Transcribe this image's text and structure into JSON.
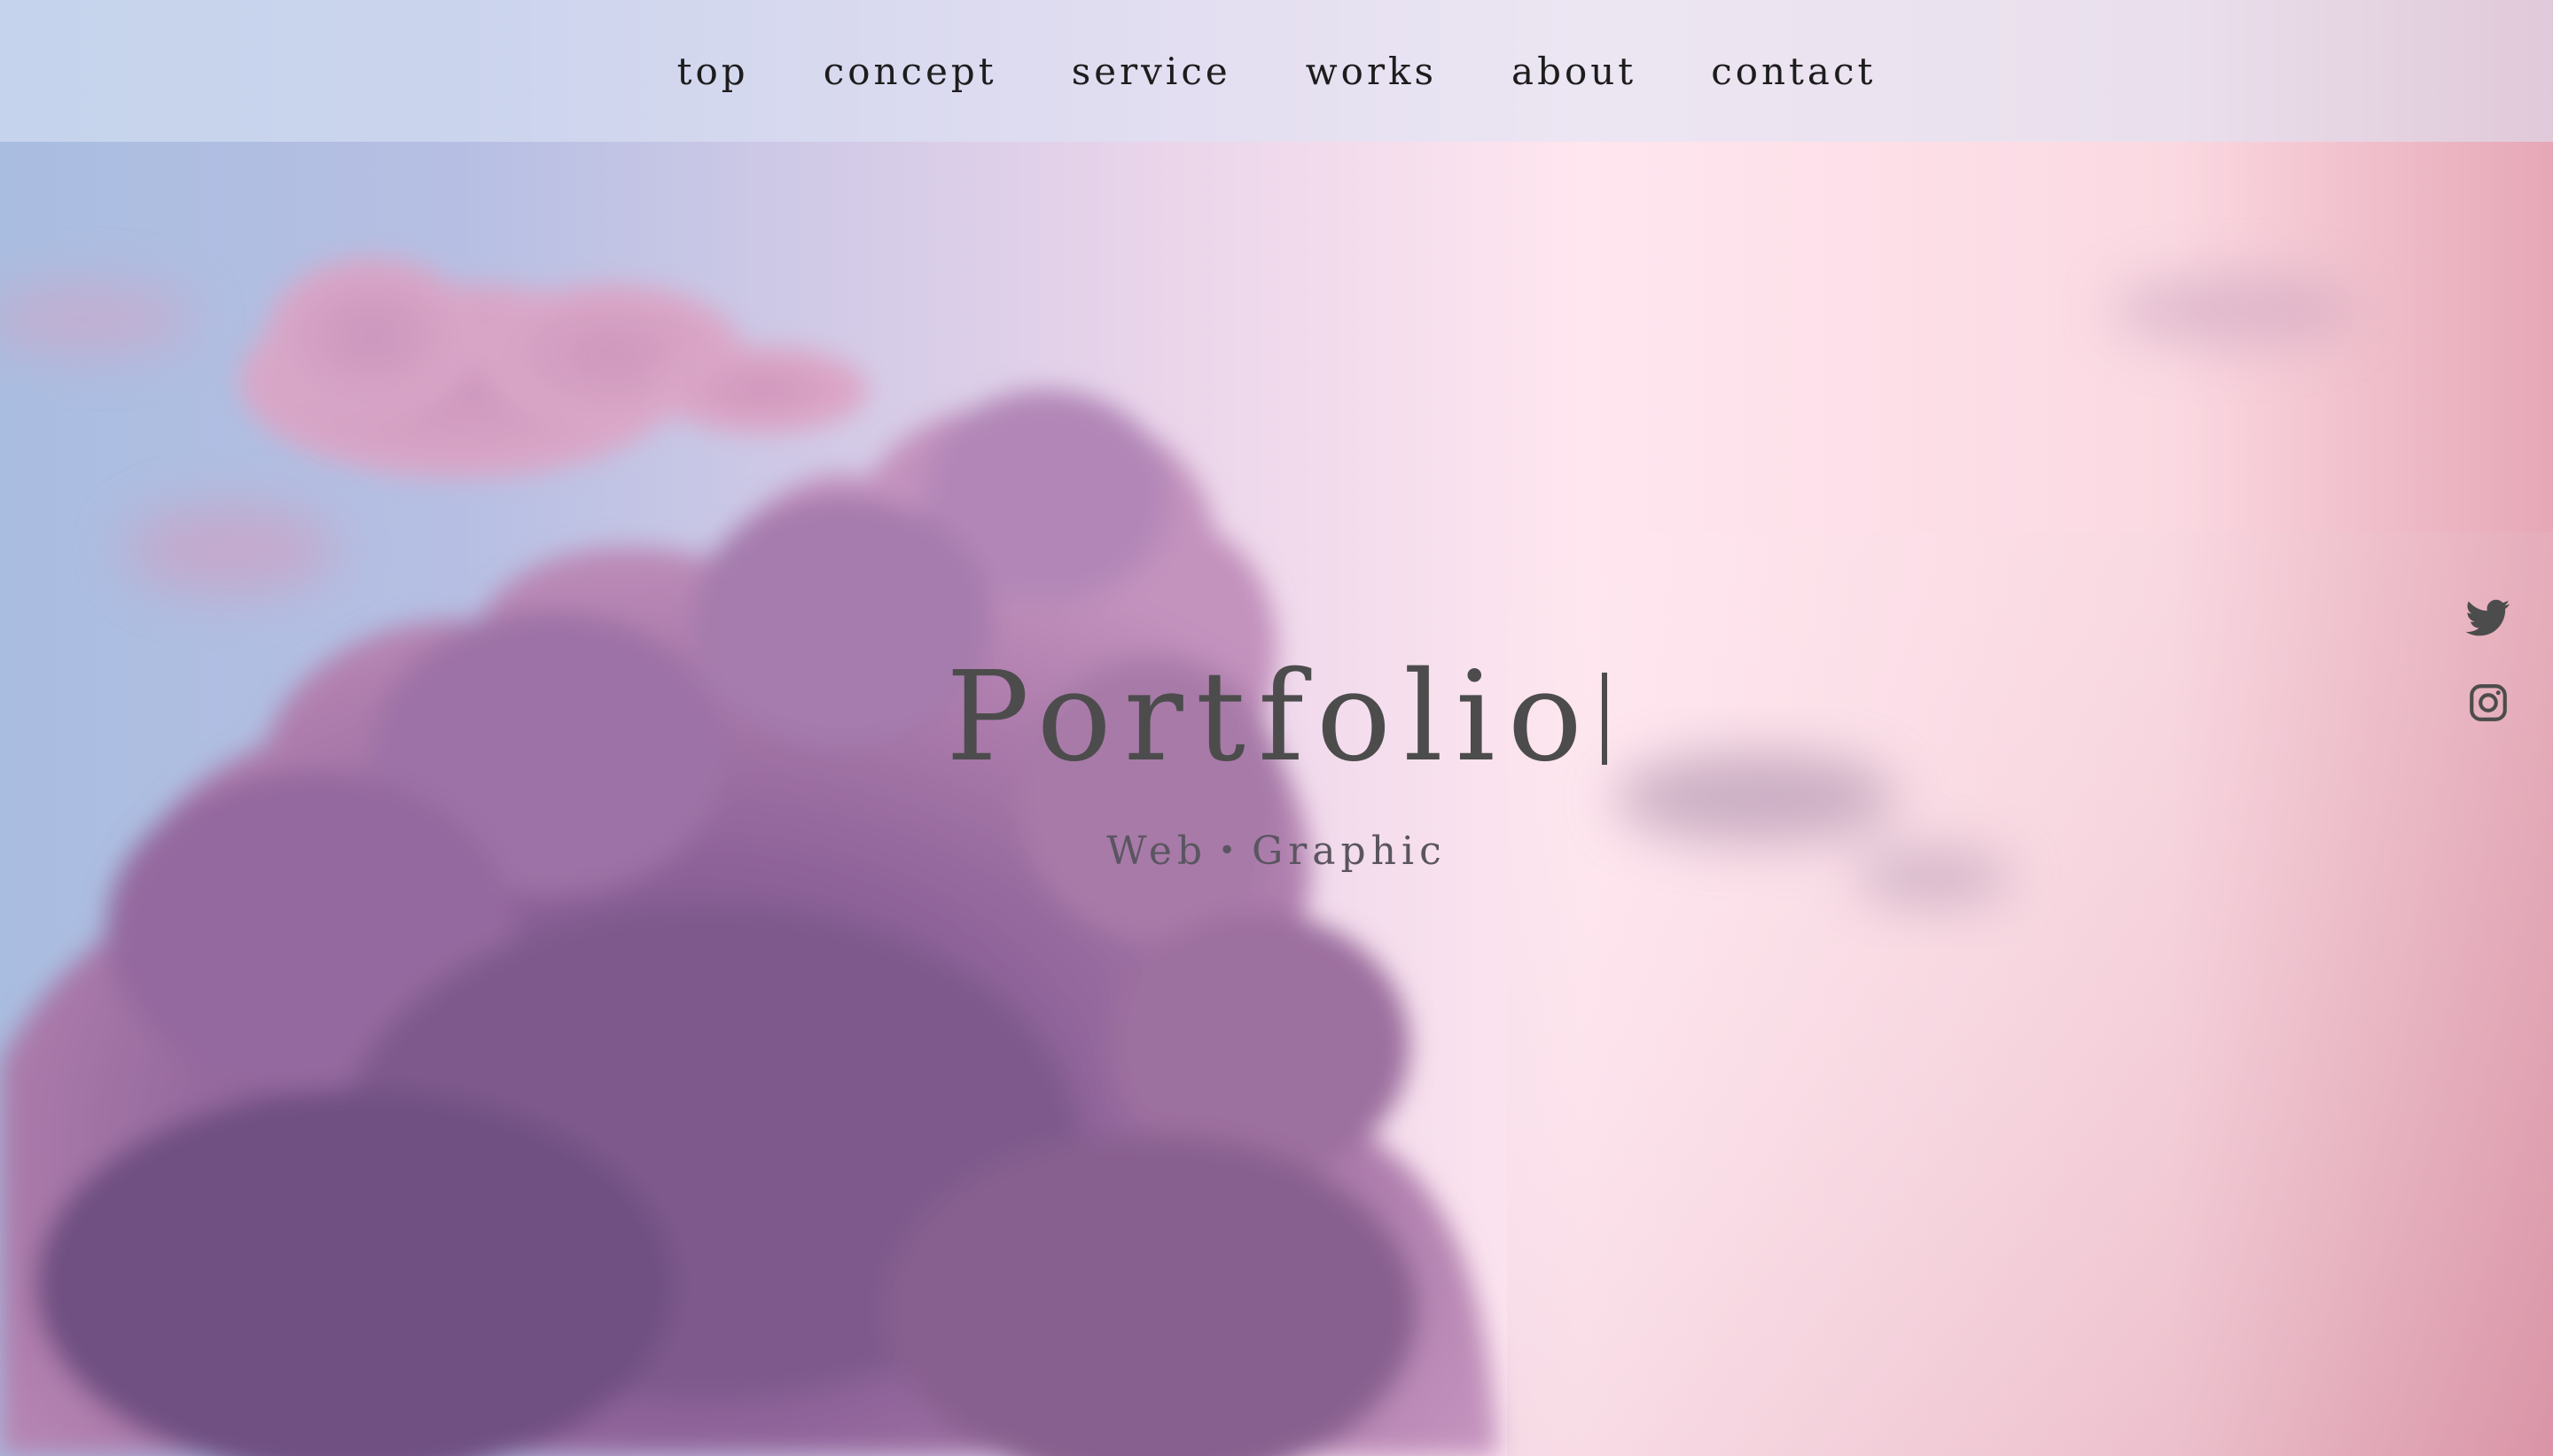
{
  "nav": {
    "items": [
      {
        "label": "top"
      },
      {
        "label": "concept"
      },
      {
        "label": "service"
      },
      {
        "label": "works"
      },
      {
        "label": "about"
      },
      {
        "label": "contact"
      }
    ]
  },
  "hero": {
    "title": "Portfolio",
    "subtitle": "Web・Graphic",
    "background": "pastel pink and lavender sky with a large purple cumulus cloud"
  },
  "social": {
    "items": [
      {
        "icon": "twitter-icon"
      },
      {
        "icon": "instagram-icon"
      }
    ]
  },
  "colors": {
    "text": "#4c4c4c",
    "nav_text": "#1d1d1d",
    "sky_blue": "#a9bde0",
    "sky_pink": "#ffe6ef",
    "cloud_purple": "#9a6a9e"
  }
}
